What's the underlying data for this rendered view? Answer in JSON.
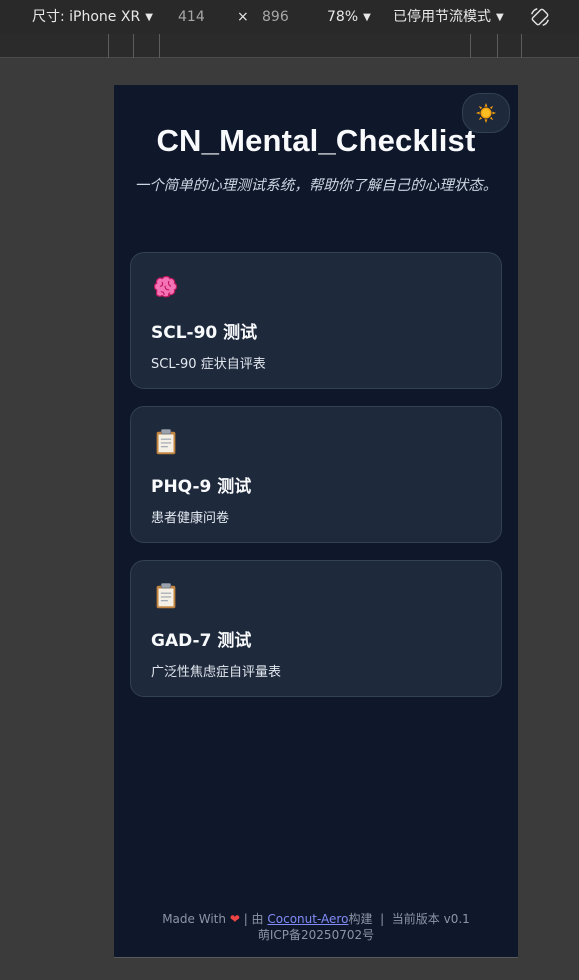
{
  "devtools": {
    "size_label": "尺寸: iPhone XR",
    "width": "414",
    "times": "×",
    "height": "896",
    "zoom": "78%",
    "throttle": "已停用节流模式"
  },
  "header": {
    "title": "CN_Mental_Checklist",
    "subtitle": "一个简单的心理测试系统，帮助你了解自己的心理状态。"
  },
  "tests": [
    {
      "title": "SCL-90 测试",
      "description": "SCL-90 症状自评表",
      "icon": "brain-icon"
    },
    {
      "title": "PHQ-9 测试",
      "description": "患者健康问卷",
      "icon": "clipboard-icon"
    },
    {
      "title": "GAD-7 测试",
      "description": "广泛性焦虑症自评量表",
      "icon": "clipboard-icon"
    }
  ],
  "footer": {
    "made_with": "Made With",
    "heart": "❤",
    "by": "| 由",
    "author": "Coconut-Aero",
    "built": "构建",
    "separator": "|",
    "version": "当前版本 v0.1",
    "icp": "萌ICP备20250702号"
  },
  "colors": {
    "background": "#0f172a",
    "card": "#1e293b",
    "link": "#818cf8"
  }
}
